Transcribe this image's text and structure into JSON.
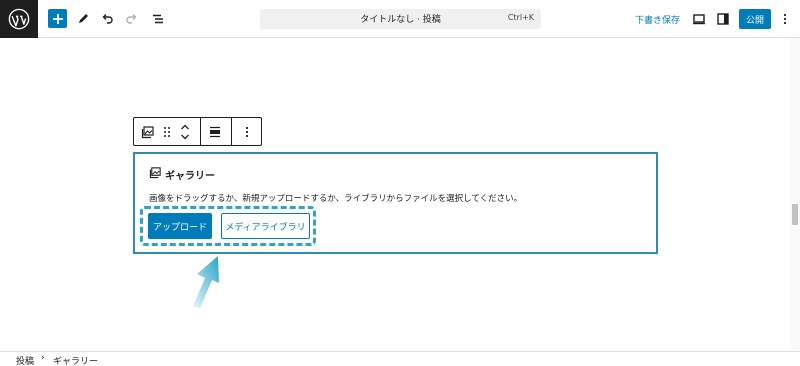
{
  "header": {
    "title": "タイトルなし · 投稿",
    "shortcut": "Ctrl+K",
    "save_draft_label": "下書き保存",
    "publish_label": "公開"
  },
  "gallery": {
    "title": "ギャラリー",
    "instructions": "画像をドラッグするか、新規アップロードするか、ライブラリからファイルを選択してください。",
    "upload_label": "アップロード",
    "media_library_label": "メディアライブラリ"
  },
  "breadcrumb": {
    "items": [
      "投稿",
      "ギャラリー"
    ],
    "separator": "›"
  },
  "colors": {
    "accent": "#007cba",
    "highlight": "#2ba4c8"
  }
}
